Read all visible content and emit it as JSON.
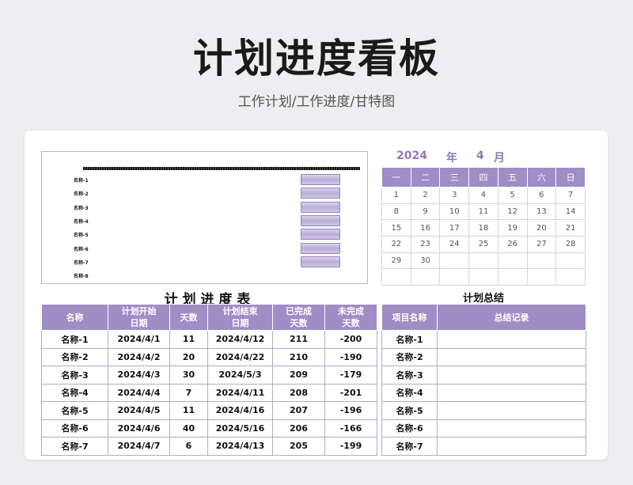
{
  "header": {
    "title": "计划进度看板",
    "subtitle": "工作计划/工作进度/甘特图"
  },
  "gantt": {
    "labels": [
      "名称-1",
      "名称-2",
      "名称-3",
      "名称-4",
      "名称-5",
      "名称-6",
      "名称-7",
      "名称-8"
    ]
  },
  "calendar": {
    "year": "2024",
    "year_unit": "年",
    "month": "4",
    "month_unit": "月",
    "weekdays": [
      "一",
      "二",
      "三",
      "四",
      "五",
      "六",
      "日"
    ],
    "weeks": [
      [
        "1",
        "2",
        "3",
        "4",
        "5",
        "6",
        "7"
      ],
      [
        "8",
        "9",
        "10",
        "11",
        "12",
        "13",
        "14"
      ],
      [
        "15",
        "16",
        "17",
        "18",
        "19",
        "20",
        "21"
      ],
      [
        "22",
        "23",
        "24",
        "25",
        "26",
        "27",
        "28"
      ],
      [
        "29",
        "30",
        "",
        "",
        "",
        "",
        ""
      ],
      [
        "",
        "",
        "",
        "",
        "",
        "",
        ""
      ]
    ]
  },
  "plan": {
    "title": "计 划 进 度 表",
    "headers": [
      "名称",
      "计划开始\n日期",
      "天数",
      "计划结束\n日期",
      "已完成\n天数",
      "未完成\n天数"
    ],
    "rows": [
      [
        "名称-1",
        "2024/4/1",
        "11",
        "2024/4/12",
        "211",
        "-200"
      ],
      [
        "名称-2",
        "2024/4/2",
        "20",
        "2024/4/22",
        "210",
        "-190"
      ],
      [
        "名称-3",
        "2024/4/3",
        "30",
        "2024/5/3",
        "209",
        "-179"
      ],
      [
        "名称-4",
        "2024/4/4",
        "7",
        "2024/4/11",
        "208",
        "-201"
      ],
      [
        "名称-5",
        "2024/4/5",
        "11",
        "2024/4/16",
        "207",
        "-196"
      ],
      [
        "名称-6",
        "2024/4/6",
        "40",
        "2024/5/16",
        "206",
        "-166"
      ],
      [
        "名称-7",
        "2024/4/7",
        "6",
        "2024/4/13",
        "205",
        "-199"
      ]
    ]
  },
  "summary": {
    "title": "计划总结",
    "headers": [
      "项目名称",
      "总结记录"
    ],
    "rows": [
      [
        "名称-1",
        ""
      ],
      [
        "名称-2",
        ""
      ],
      [
        "名称-3",
        ""
      ],
      [
        "名称-4",
        ""
      ],
      [
        "名称-5",
        ""
      ],
      [
        "名称-6",
        ""
      ],
      [
        "名称-7",
        ""
      ]
    ]
  },
  "colors": {
    "accent": "#9f8dc6",
    "accent_text": "#8e7bb6",
    "border": "#b3aad0"
  }
}
